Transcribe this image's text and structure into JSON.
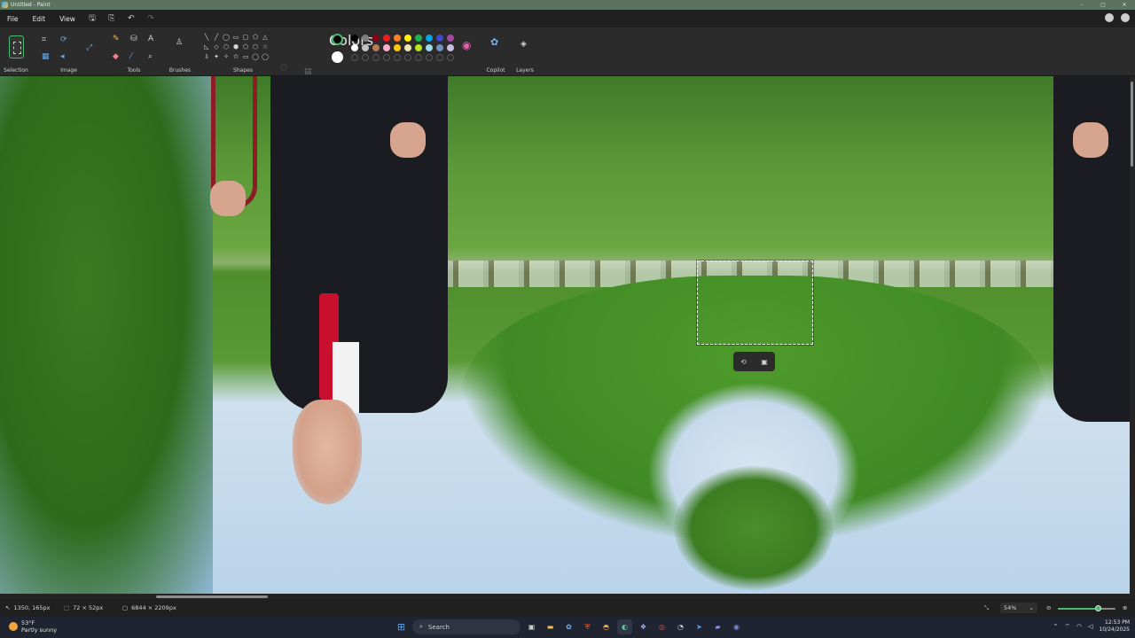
{
  "window": {
    "title": "Untitled - Paint",
    "controls": [
      "–",
      "▢",
      "✕"
    ]
  },
  "menu": {
    "items": [
      "File",
      "Edit",
      "View"
    ],
    "quick": [
      "save-icon",
      "share-icon",
      "undo-icon",
      "redo-icon"
    ]
  },
  "ribbon": {
    "groups": {
      "selection": "Selection",
      "image": "Image",
      "tools": "Tools",
      "brushes": "Brushes",
      "shapes": "Shapes",
      "colors": "Colors",
      "copilot": "Copilot",
      "layers": "Layers"
    },
    "shape_glyphs": [
      "╲",
      "╱",
      "◯",
      "▭",
      "▢",
      "⬠",
      "△",
      "◺",
      "◇",
      "⬡",
      "⬢",
      "⬠",
      "⬡",
      "☆",
      "⇩",
      "✦",
      "✧",
      "✩",
      "▭",
      "◯",
      "◯",
      "",
      "",
      "",
      "",
      "",
      "",
      ""
    ],
    "current_colors": {
      "primary": "#000000",
      "secondary": "#ffffff"
    },
    "palette_row1": [
      "#000000",
      "#7f7f7f",
      "#880015",
      "#ed1c24",
      "#ff7f27",
      "#fff200",
      "#22b14c",
      "#00a2e8",
      "#3f48cc",
      "#a349a4"
    ],
    "palette_row2": [
      "#ffffff",
      "#c3c3c3",
      "#b97a57",
      "#ffaec9",
      "#ffc90e",
      "#efe4b0",
      "#b5e61d",
      "#99d9ea",
      "#7092be",
      "#c8bfe7"
    ]
  },
  "status": {
    "cursor_position": "1350, 165px",
    "selection_size": "72 × 52px",
    "canvas_size": "6844 × 2209px",
    "zoom": "54%",
    "zoom_fraction": 0.7
  },
  "taskbar": {
    "weather_temp": "53°F",
    "weather_desc": "Partly sunny",
    "search_placeholder": "Search",
    "time": "12:53 PM",
    "date": "10/24/2025"
  },
  "selection_toolbar": [
    "rotate-icon",
    "ai-select-icon"
  ]
}
